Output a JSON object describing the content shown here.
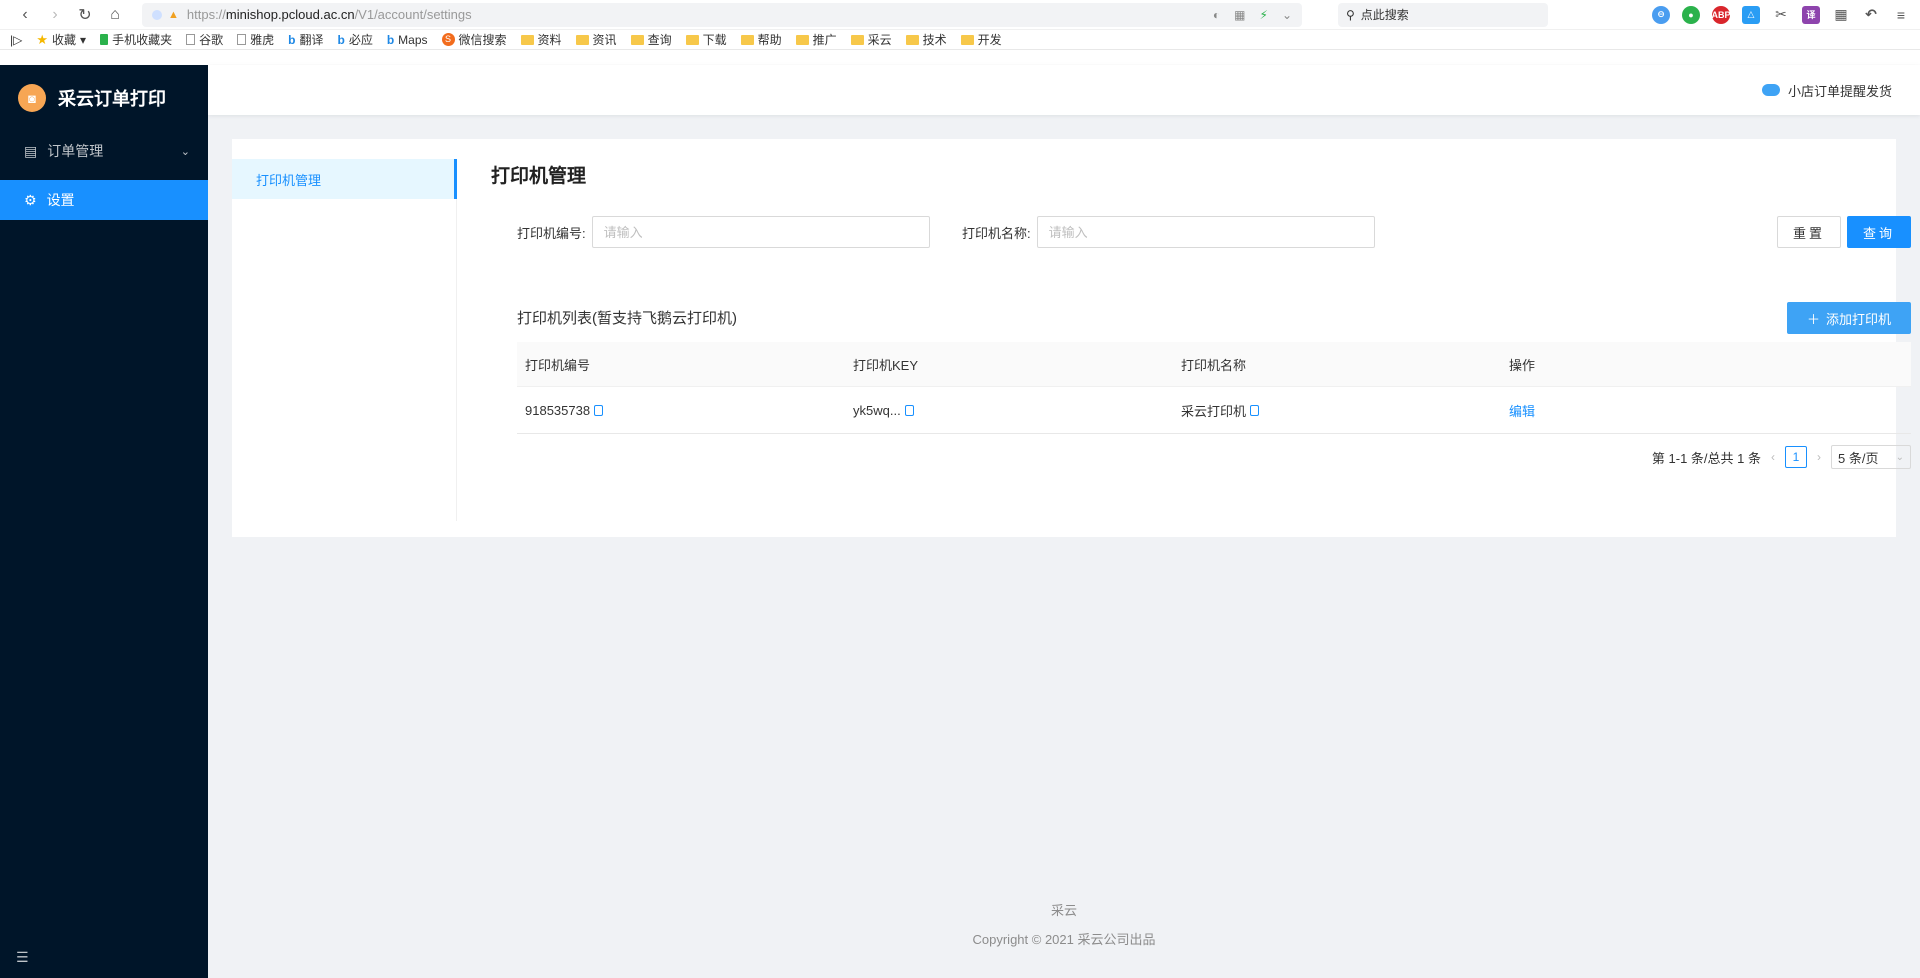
{
  "browser": {
    "url_scheme": "https://",
    "url_host": "minishop.pcloud.ac.cn",
    "url_path": "/V1/account/settings",
    "search_placeholder": "点此搜索",
    "bookmarks": [
      "收藏",
      "手机收藏夹",
      "谷歌",
      "雅虎",
      "翻译",
      "必应",
      "Maps",
      "微信搜索",
      "资料",
      "资讯",
      "查询",
      "下载",
      "帮助",
      "推广",
      "采云",
      "技术",
      "开发"
    ]
  },
  "app": {
    "logo_text": "采云订单打印",
    "menu": [
      {
        "label": "订单管理"
      },
      {
        "label": "设置"
      }
    ],
    "topbar_text": "小店订单提醒发货"
  },
  "settings": {
    "submenu_label": "打印机管理",
    "page_title": "打印机管理",
    "filter": {
      "printer_no_label": "打印机编号:",
      "printer_no_placeholder": "请输入",
      "printer_name_label": "打印机名称:",
      "printer_name_placeholder": "请输入",
      "reset_label": "重置",
      "query_label": "查询"
    },
    "list_title": "打印机列表(暂支持飞鹅云打印机)",
    "add_button_label": "添加打印机",
    "table": {
      "columns": [
        "打印机编号",
        "打印机KEY",
        "打印机名称",
        "操作"
      ],
      "rows": [
        {
          "no": "918535738",
          "key": "yk5wq...",
          "name": "采云打印机",
          "action": "编辑"
        }
      ]
    },
    "pagination": {
      "summary": "第 1-1 条/总共 1 条",
      "current_page": "1",
      "page_size": "5 条/页"
    }
  },
  "footer": {
    "line1": "采云",
    "line2": "Copyright © 2021 采云公司出品"
  }
}
